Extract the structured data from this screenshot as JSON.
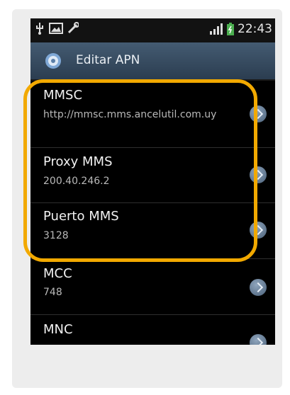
{
  "statusbar": {
    "time": "22:43"
  },
  "actionbar": {
    "title": "Editar APN"
  },
  "items": [
    {
      "title": "MMSC",
      "value": "http://mmsc.mms.ancelutil.com.uy"
    },
    {
      "title": "Proxy MMS",
      "value": "200.40.246.2"
    },
    {
      "title": "Puerto MMS",
      "value": "3128"
    },
    {
      "title": "MCC",
      "value": "748"
    },
    {
      "title": "MNC",
      "value": ""
    }
  ],
  "colors": {
    "highlight": "#f2a900",
    "actionbar": "#3a4f63",
    "background": "#000000"
  },
  "icons": [
    "usb-icon",
    "screenshot-icon",
    "tools-icon",
    "signal-icon",
    "battery-icon",
    "gear-icon",
    "chevron-right-icon"
  ]
}
